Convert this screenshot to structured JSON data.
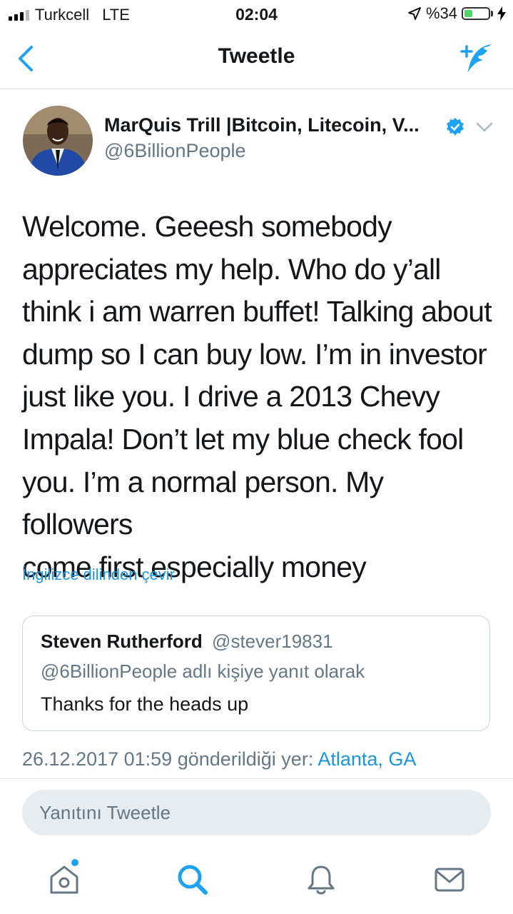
{
  "status_bar": {
    "carrier": "Turkcell",
    "network": "LTE",
    "time": "02:04",
    "battery_text": "%34",
    "battery_level": 0.34
  },
  "nav": {
    "title": "Tweetle",
    "back_icon": "chevron-left-icon",
    "compose_icon": "compose-tweet-icon"
  },
  "tweet": {
    "author_name": "MarQuis Trill |Bitcoin, Litecoin, V...",
    "handle": "@6BillionPeople",
    "verified": true,
    "text_lines": [
      "Welcome. Geeesh somebody",
      "appreciates my help. Who do y’all",
      "think i am warren buffet! Talking about",
      "dump so I can buy low. I’m in investor",
      "just like you. I drive a 2013 Chevy",
      "Impala! Don’t let my blue check fool",
      "you. I’m a normal person. My followers",
      "come first especially money"
    ],
    "translate": "İngilizce dilinden çevir",
    "timestamp": "26.12.2017 01:59 gönderildiği yer:",
    "location": "Atlanta, GA"
  },
  "quoted": {
    "name": "Steven Rutherford",
    "handle": "@stever19831",
    "replying": "@6BillionPeople adlı kişiye yanıt olarak",
    "text": "Thanks for the heads up"
  },
  "reply": {
    "placeholder": "Yanıtını Tweetle"
  },
  "tabbar": {
    "items": [
      "home-icon",
      "search-icon",
      "bell-icon",
      "envelope-icon"
    ],
    "active": "search-icon"
  },
  "colors": {
    "accent": "#1da1f2",
    "link": "#1b95e0",
    "secondary_text": "#657786",
    "battery": "#4cd964"
  }
}
